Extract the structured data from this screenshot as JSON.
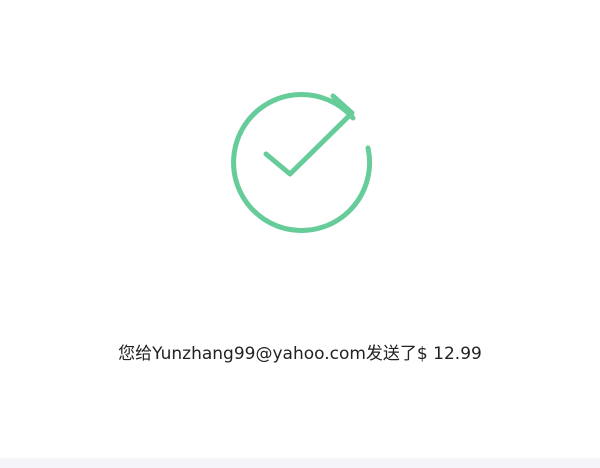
{
  "confirmation": {
    "message": "您给Yunzhang99@yahoo.com发送了$ 12.99",
    "icon": "check-circle-icon"
  },
  "colors": {
    "success": "#66cc99",
    "text": "#222222",
    "bottom_bar": "#f5f5f9"
  }
}
